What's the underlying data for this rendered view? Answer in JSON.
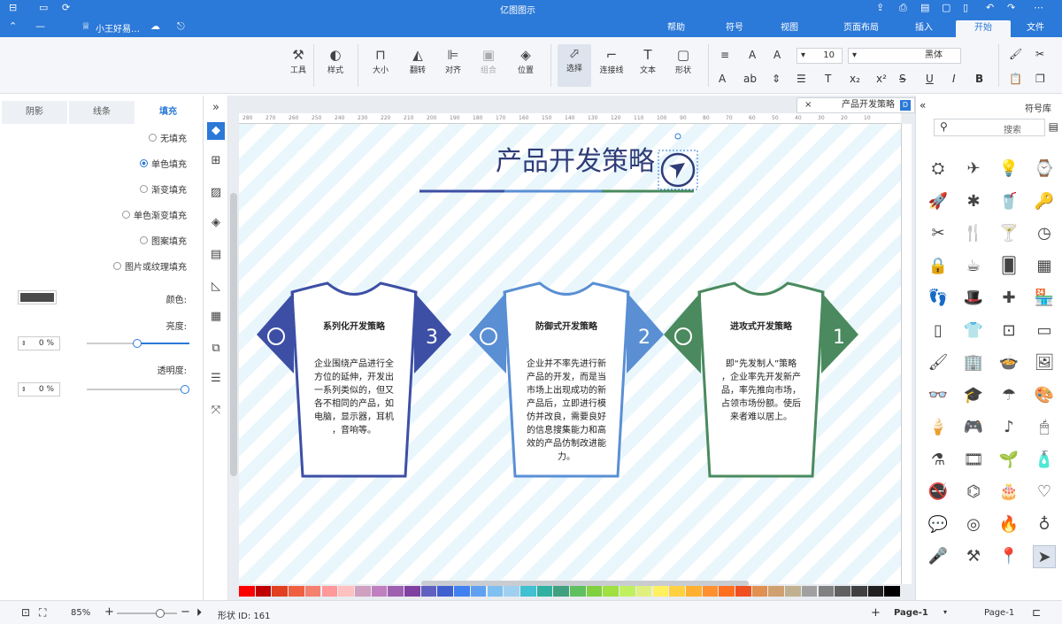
{
  "window": {
    "title": "亿图图示"
  },
  "quickbar": {
    "doc_name": "小王好易…"
  },
  "ribbon_tabs": [
    "文件",
    "开始",
    "插入",
    "页面布局",
    "视图",
    "符号",
    "帮助"
  ],
  "ribbon_active": "开始",
  "toolbar": {
    "font_name": "黑体",
    "font_size": "10",
    "select_label": "选择",
    "connector_label": "连接线",
    "text_label": "文本",
    "shape_label": "形状",
    "position_label": "位置",
    "group_label": "组合",
    "align_label": "对齐",
    "flip_label": "翻转",
    "size_label": "大小",
    "style_label": "样式",
    "tools_label": "工具",
    "bold": "B",
    "italic": "I",
    "underline": "U",
    "strike": "S"
  },
  "left_panel": {
    "tabs": [
      "填充",
      "线条",
      "阴影"
    ],
    "active_tab": "填充",
    "fill_options": [
      "无填充",
      "单色填充",
      "渐变填充",
      "单色渐变填充",
      "图案填充",
      "图片或纹理填充"
    ],
    "selected_fill": "单色填充",
    "color_label": "颜色:",
    "color_value": "#4a4a4a",
    "brightness_label": "亮度:",
    "brightness_value": "0 %",
    "transparency_label": "透明度:",
    "transparency_value": "0 %"
  },
  "doc_tab": {
    "label": "产品开发策略"
  },
  "diagram": {
    "title": "产品开发策略",
    "shirts": [
      {
        "number": "1",
        "heading": "进攻式开发策略",
        "body": "即“先发制人”策略，企业率先开发新产品，率先推向市场，占领市场份额。使后来者难以居上。",
        "color": "#4a8a5e"
      },
      {
        "number": "2",
        "heading": "防御式开发策略",
        "body": "企业并不率先进行新产品的开发，而是当市场上出现成功的新产品后，立即进行模仿并改良，需要良好的信息搜集能力和高效的产品仿制改进能力。",
        "color": "#5a8fd4"
      },
      {
        "number": "3",
        "heading": "系列化开发策略",
        "body": "企业围绕产品进行全方位的延伸，开发出一系列类似的，但又各不相同的产品，如电脑，显示器，耳机，音响等。",
        "color": "#3d4fa5"
      }
    ]
  },
  "ruler_ticks": [
    "280",
    "270",
    "260",
    "250",
    "240",
    "230",
    "220",
    "210",
    "200",
    "190",
    "180",
    "170",
    "160",
    "150",
    "140",
    "130",
    "120",
    "110",
    "100",
    "90",
    "80",
    "70",
    "60",
    "50",
    "40",
    "30",
    "20",
    "10"
  ],
  "right_panel": {
    "title": "符号库",
    "search_placeholder": "搜索",
    "symbols": [
      "space-icon",
      "bird-icon",
      "bulb-icon",
      "watch-icon",
      "rocket-icon",
      "fan-icon",
      "drink-icon",
      "key-icon",
      "cutlery-icon",
      "fork-knife-icon",
      "cocktail-icon",
      "clock-icon",
      "lock-icon",
      "coffee-icon",
      "cards-icon",
      "grid-icon",
      "footprint-icon",
      "hat-icon",
      "first-aid-icon",
      "shop-icon",
      "phone-icon",
      "shirt-icon",
      "safe-icon",
      "ac-icon",
      "brush-icon",
      "building-icon",
      "food-icon",
      "picture-icon",
      "glasses-icon",
      "graduation-icon",
      "umbrella-icon",
      "palette-icon",
      "icecream-icon",
      "gamepad-icon",
      "music-icon",
      "mouse-icon",
      "flask-icon",
      "film-icon",
      "plant-icon",
      "bottle-icon",
      "no-smoking-icon",
      "binoculars-icon",
      "cake-icon",
      "heart-icon",
      "chat-icon",
      "target-icon",
      "fire-icon",
      "bulb2-icon",
      "mic-icon",
      "hammer-icon",
      "pin-icon",
      "navigate-icon"
    ]
  },
  "statusbar": {
    "page_label": "Page-1",
    "page_tab": "Page-1",
    "shape_id": "形状 ID: 161",
    "zoom": "85%"
  },
  "palette_colors": [
    "#ff0000",
    "#c00000",
    "#e0401f",
    "#f06040",
    "#f48070",
    "#ff9999",
    "#ffc0c0",
    "#d0a0c0",
    "#c080c0",
    "#a060b0",
    "#8040a0",
    "#6060c0",
    "#4060d0",
    "#4080f0",
    "#60a0f0",
    "#80c0f0",
    "#a0d0f0",
    "#40c0d0",
    "#30b0a0",
    "#40a080",
    "#60c060",
    "#80d040",
    "#a0e040",
    "#c0f060",
    "#e0f080",
    "#fff060",
    "#ffd040",
    "#ffb030",
    "#ff9030",
    "#ff7020",
    "#f05020",
    "#e09050",
    "#d0a070",
    "#c0b090",
    "#a0a0a0",
    "#808080",
    "#606060",
    "#404040",
    "#202020",
    "#000000"
  ]
}
